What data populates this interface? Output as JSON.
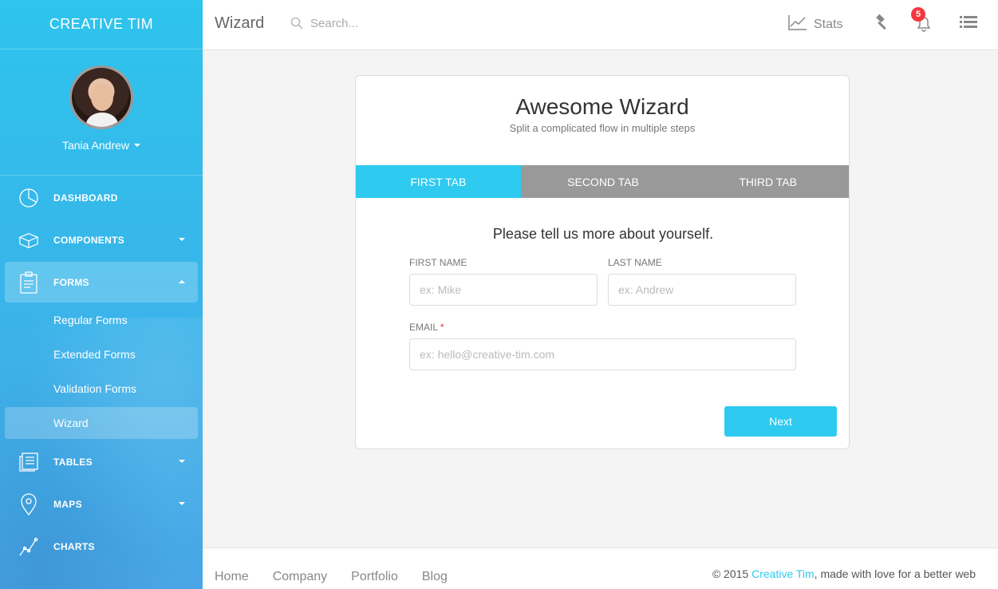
{
  "sidebar": {
    "brand": "CREATIVE TIM",
    "user_name": "Tania Andrew",
    "items": [
      {
        "label": "DASHBOARD",
        "icon": "pie-chart-icon"
      },
      {
        "label": "COMPONENTS",
        "icon": "box-icon"
      },
      {
        "label": "FORMS",
        "icon": "clipboard-icon"
      },
      {
        "label": "TABLES",
        "icon": "table-icon"
      },
      {
        "label": "MAPS",
        "icon": "map-pin-icon"
      },
      {
        "label": "CHARTS",
        "icon": "line-chart-icon"
      }
    ],
    "forms_sub": [
      "Regular Forms",
      "Extended Forms",
      "Validation Forms",
      "Wizard"
    ]
  },
  "topbar": {
    "title": "Wizard",
    "search_placeholder": "Search...",
    "stats_label": "Stats",
    "notification_count": "5"
  },
  "card": {
    "title": "Awesome Wizard",
    "subtitle": "Split a complicated flow in multiple steps",
    "tabs": [
      "FIRST TAB",
      "SECOND TAB",
      "THIRD TAB"
    ],
    "question": "Please tell us more about yourself.",
    "first_name_label": "FIRST NAME",
    "first_name_placeholder": "ex: Mike",
    "last_name_label": "LAST NAME",
    "last_name_placeholder": "ex: Andrew",
    "email_label": "EMAIL",
    "email_required_mark": "*",
    "email_placeholder": "ex: hello@creative-tim.com",
    "next_label": "Next"
  },
  "footer": {
    "links": [
      "Home",
      "Company",
      "Portfolio",
      "Blog"
    ],
    "copyright_prefix": "© 2015 ",
    "copyright_brand": "Creative Tim",
    "copyright_suffix": ", made with love for a better web"
  },
  "colors": {
    "accent": "#2ecaf0",
    "badge": "#f5363e",
    "tab_inactive": "#999999"
  }
}
